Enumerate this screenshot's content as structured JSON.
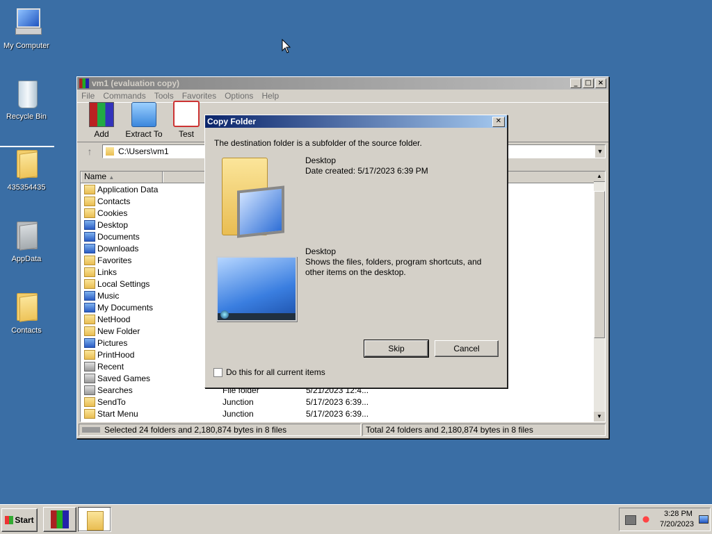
{
  "desktop": {
    "icons": [
      {
        "label": "My Computer",
        "icon": "my-computer-icon"
      },
      {
        "label": "Recycle Bin",
        "icon": "recycle-bin-icon"
      },
      {
        "label": "435354435",
        "icon": "folder-icon"
      },
      {
        "label": "AppData",
        "icon": "folder-icon"
      },
      {
        "label": "Contacts",
        "icon": "folder-icon"
      }
    ]
  },
  "winrar": {
    "title": "vm1 (evaluation copy)",
    "menu": [
      "File",
      "Commands",
      "Tools",
      "Favorites",
      "Options",
      "Help"
    ],
    "toolbar": {
      "add": "Add",
      "extract": "Extract To",
      "test": "Test"
    },
    "address": "C:\\Users\\vm1",
    "columns": {
      "name": "Name"
    },
    "files": [
      {
        "name": "Application Data"
      },
      {
        "name": "Contacts"
      },
      {
        "name": "Cookies"
      },
      {
        "name": "Desktop"
      },
      {
        "name": "Documents"
      },
      {
        "name": "Downloads"
      },
      {
        "name": "Favorites"
      },
      {
        "name": "Links"
      },
      {
        "name": "Local Settings"
      },
      {
        "name": "Music"
      },
      {
        "name": "My Documents"
      },
      {
        "name": "NetHood"
      },
      {
        "name": "New Folder"
      },
      {
        "name": "Pictures"
      },
      {
        "name": "PrintHood"
      },
      {
        "name": "Recent"
      },
      {
        "name": "Saved Games"
      },
      {
        "name": "Searches",
        "type": "File folder",
        "modified": "5/21/2023 12:4..."
      },
      {
        "name": "SendTo",
        "type": "Junction",
        "modified": "5/17/2023 6:39..."
      },
      {
        "name": "Start Menu",
        "type": "Junction",
        "modified": "5/17/2023 6:39..."
      }
    ],
    "status_left": "Selected 24 folders and 2,180,874 bytes in 8 files",
    "status_right": "Total 24 folders and 2,180,874 bytes in 8 files"
  },
  "dialog": {
    "title": "Copy Folder",
    "message": "The destination folder is a subfolder of the source folder.",
    "source": {
      "name": "Desktop",
      "detail": "Date created: 5/17/2023 6:39 PM"
    },
    "dest": {
      "name": "Desktop",
      "detail": "Shows the files, folders, program shortcuts, and other items on the desktop."
    },
    "skip": "Skip",
    "cancel": "Cancel",
    "checkbox_label": "Do this for all current items",
    "close_glyph": "✕"
  },
  "taskbar": {
    "start": "Start",
    "time": "3:28 PM",
    "date": "7/20/2023"
  }
}
